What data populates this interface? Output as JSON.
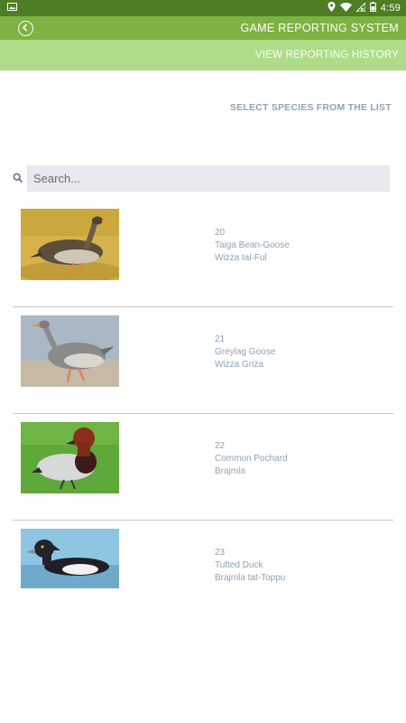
{
  "status_bar": {
    "time": "4:59",
    "icons": [
      "image-notification-icon",
      "location-icon",
      "wifi-icon",
      "signal-icon",
      "battery-icon"
    ]
  },
  "app_bar": {
    "title": "GAME REPORTING SYSTEM",
    "back_icon": "back-circle-icon"
  },
  "sub_bar": {
    "history_link": "VIEW REPORTING HISTORY"
  },
  "main": {
    "select_label": "SELECT SPECIES FROM THE LIST",
    "search": {
      "placeholder": "Search...",
      "value": ""
    }
  },
  "species": [
    {
      "number": "20",
      "english": "Taiga Bean-Goose",
      "maltese": "Wiżża tal-Ful"
    },
    {
      "number": "21",
      "english": "Greylag Goose",
      "maltese": "Wiżża Griża"
    },
    {
      "number": "22",
      "english": "Common Pochard",
      "maltese": "Brajmla"
    },
    {
      "number": "23",
      "english": "Tufted Duck",
      "maltese": "Brajmla tat-Toppu"
    }
  ],
  "colors": {
    "status_bar": "#4f7d23",
    "app_bar": "#7cb342",
    "sub_bar": "#aedc88",
    "species_text": "#8ea2b2"
  }
}
